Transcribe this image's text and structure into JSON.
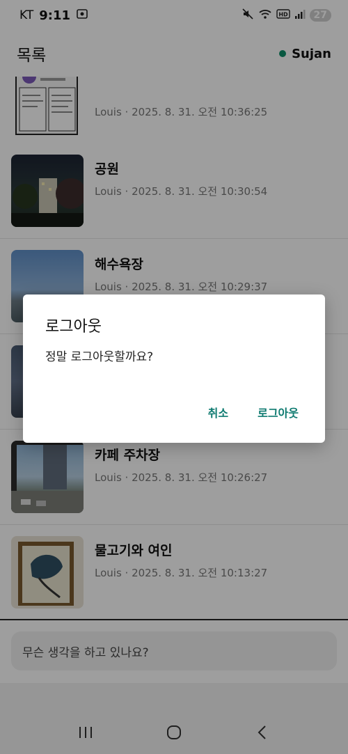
{
  "status_bar": {
    "carrier": "KT",
    "time": "9:11",
    "battery": "27",
    "icons": [
      "screenshot-icon",
      "mute-icon",
      "wifi-icon",
      "hd-icon",
      "signal-icon"
    ]
  },
  "header": {
    "title": "목록",
    "user_name": "Sujan",
    "online_color": "#0f8f6a"
  },
  "feed": {
    "items": [
      {
        "title": "",
        "meta": "Louis · 2025. 8. 31. 오전 10:36:25"
      },
      {
        "title": "공원",
        "meta": "Louis · 2025. 8. 31. 오전 10:30:54"
      },
      {
        "title": "해수욕장",
        "meta": "Louis · 2025. 8. 31. 오전 10:29:37"
      },
      {
        "title": "",
        "meta": ""
      },
      {
        "title": "카페 주차장",
        "meta": "Louis · 2025. 8. 31. 오전 10:26:27"
      },
      {
        "title": "물고기와 여인",
        "meta": "Louis · 2025. 8. 31. 오전 10:13:27"
      }
    ]
  },
  "composer": {
    "placeholder": "무슨 생각을 하고 있나요?"
  },
  "dialog": {
    "title": "로그아웃",
    "message": "정말 로그아웃할까요?",
    "cancel_label": "취소",
    "confirm_label": "로그아웃",
    "accent": "#0e7a70"
  },
  "nav": {
    "icons": [
      "recent-apps-icon",
      "home-icon",
      "back-icon"
    ]
  }
}
